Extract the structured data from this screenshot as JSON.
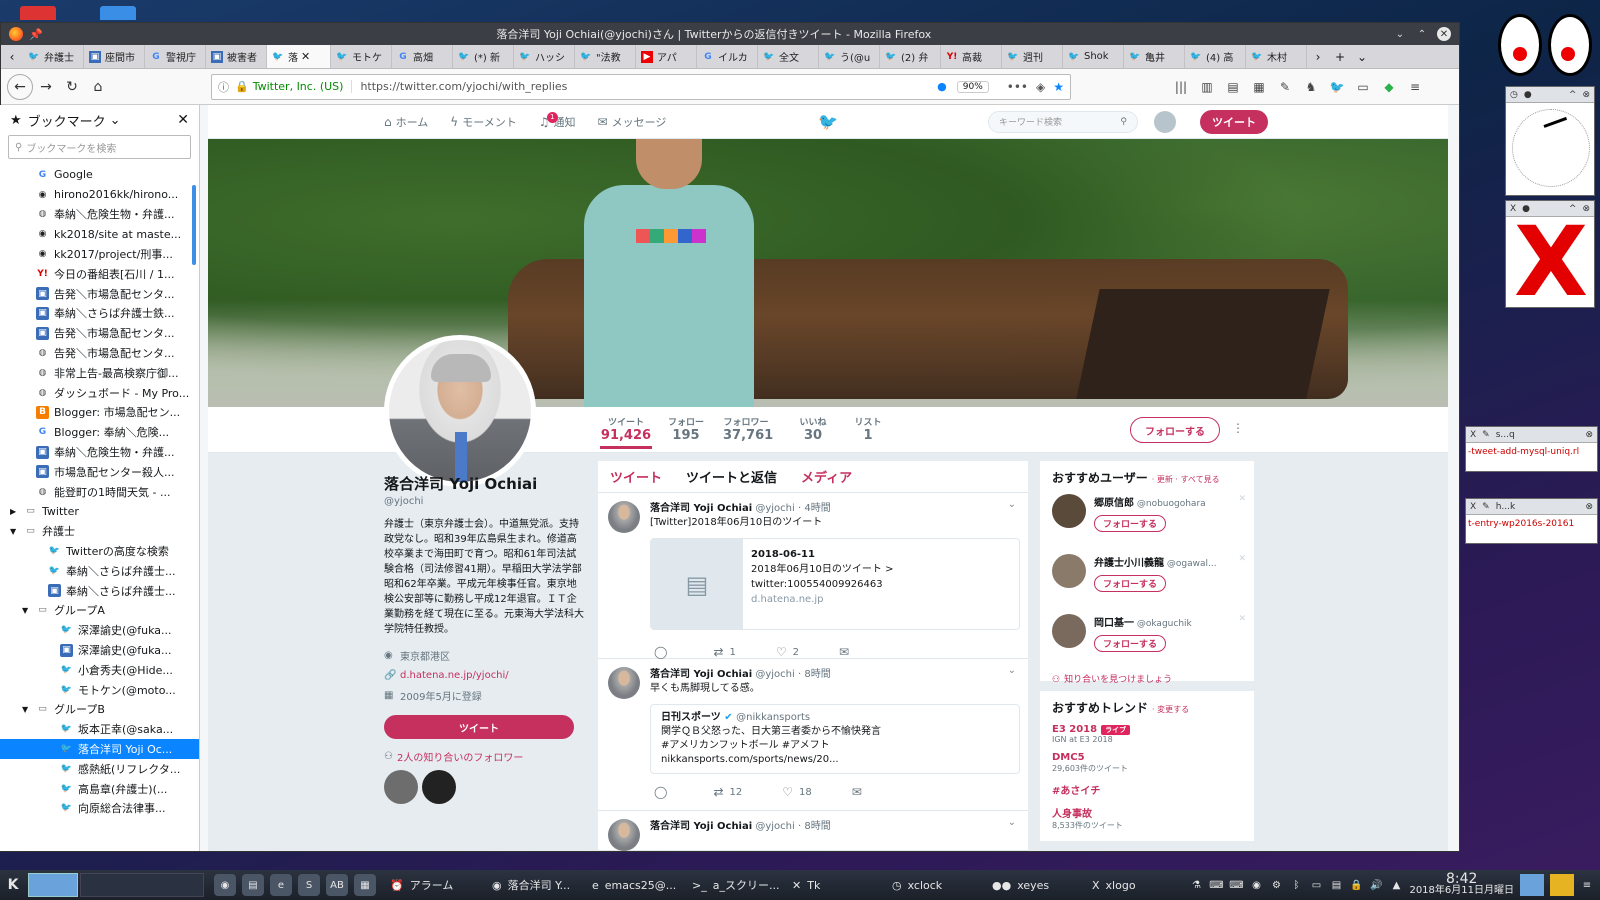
{
  "window": {
    "title": "落合洋司 Yoji Ochiai(@yjochi)さん | Twitterからの返信付きツイート - Mozilla Firefox"
  },
  "tabs": [
    {
      "label": "弁護士",
      "icon": "twitter-icon"
    },
    {
      "label": "座間市",
      "icon": "page-icon"
    },
    {
      "label": "警視庁",
      "icon": "google-icon"
    },
    {
      "label": "被害者",
      "icon": "page-icon"
    },
    {
      "label": "落",
      "icon": "twitter-icon",
      "active": true
    },
    {
      "label": "モトケ",
      "icon": "twitter-icon"
    },
    {
      "label": "高畑",
      "icon": "google-icon"
    },
    {
      "label": "(*) 新",
      "icon": "twitter-icon"
    },
    {
      "label": "ハッシ",
      "icon": "twitter-icon"
    },
    {
      "label": "\"法教",
      "icon": "twitter-icon"
    },
    {
      "label": "アパ",
      "icon": "youtube-icon"
    },
    {
      "label": "イルカ",
      "icon": "google-icon"
    },
    {
      "label": "全文",
      "icon": "twitter-icon"
    },
    {
      "label": "う(@u",
      "icon": "twitter-icon"
    },
    {
      "label": "(2) 弁",
      "icon": "twitter-icon"
    },
    {
      "label": "高裁",
      "icon": "yahoo-icon"
    },
    {
      "label": "週刊",
      "icon": "twitter-icon"
    },
    {
      "label": "Shok",
      "icon": "twitter-icon"
    },
    {
      "label": "亀井",
      "icon": "twitter-icon"
    },
    {
      "label": "(4) 高",
      "icon": "twitter-icon"
    },
    {
      "label": "木村",
      "icon": "twitter-icon"
    }
  ],
  "urlbar": {
    "identity": "Twitter, Inc. (US)",
    "url": "https://twitter.com/yjochi/with_replies",
    "zoom": "90%"
  },
  "sidebar": {
    "title": "ブックマーク",
    "search_placeholder": "ブックマークを検索",
    "items": [
      {
        "label": "Google",
        "icon": "google-icon",
        "indent": 3
      },
      {
        "label": "hirono2016kk/hirono...",
        "icon": "github-icon",
        "indent": 3
      },
      {
        "label": "奉納＼危険生物・弁護...",
        "icon": "globe-icon",
        "indent": 3
      },
      {
        "label": "kk2018/site at maste...",
        "icon": "github-icon",
        "indent": 3
      },
      {
        "label": "kk2017/project/刑事...",
        "icon": "github-icon",
        "indent": 3
      },
      {
        "label": "今日の番組表[石川 / 1...",
        "icon": "yahoo-icon",
        "indent": 3
      },
      {
        "label": "告発＼市場急配センタ...",
        "icon": "page-icon",
        "indent": 3
      },
      {
        "label": "奉納＼さらば弁護士鉄...",
        "icon": "page-icon",
        "indent": 3
      },
      {
        "label": "告発＼市場急配センタ...",
        "icon": "page-icon",
        "indent": 3
      },
      {
        "label": "告発＼市場急配センタ...",
        "icon": "globe-icon",
        "indent": 3
      },
      {
        "label": "非常上告-最高検察庁御...",
        "icon": "globe-icon",
        "indent": 3
      },
      {
        "label": "ダッシュボード - My Pro...",
        "icon": "globe-icon",
        "indent": 3
      },
      {
        "label": "Blogger: 市場急配セン...",
        "icon": "blogger-icon",
        "indent": 3
      },
      {
        "label": "Blogger: 奉納＼危険...",
        "icon": "google-icon",
        "indent": 3
      },
      {
        "label": "奉納＼危険生物・弁護...",
        "icon": "page-icon",
        "indent": 3
      },
      {
        "label": "市場急配センター殺人...",
        "icon": "page-icon",
        "indent": 3
      },
      {
        "label": "能登町の1時間天気 - ...",
        "icon": "globe-icon",
        "indent": 3
      },
      {
        "label": "Twitter",
        "icon": "folder-icon",
        "indent": 2,
        "arrow": "▶"
      },
      {
        "label": "弁護士",
        "icon": "folder-icon",
        "indent": 2,
        "arrow": "▼"
      },
      {
        "label": "Twitterの高度な検索",
        "icon": "twitter-icon",
        "indent": 4
      },
      {
        "label": "奉納＼さらば弁護士...",
        "icon": "twitter-icon",
        "indent": 4
      },
      {
        "label": "奉納＼さらば弁護士...",
        "icon": "page-icon",
        "indent": 4
      },
      {
        "label": "グループA",
        "icon": "folder-icon",
        "indent": 3,
        "arrow": "▼"
      },
      {
        "label": "深澤諭史(@fuka...",
        "icon": "twitter-icon",
        "indent": 5
      },
      {
        "label": "深澤諭史(@fuka...",
        "icon": "page-icon",
        "indent": 5
      },
      {
        "label": "小倉秀夫(@Hide...",
        "icon": "twitter-icon",
        "indent": 5
      },
      {
        "label": "モトケン(@moto...",
        "icon": "twitter-icon",
        "indent": 5
      },
      {
        "label": "グループB",
        "icon": "folder-icon",
        "indent": 3,
        "arrow": "▼"
      },
      {
        "label": "坂本正幸(@saka...",
        "icon": "twitter-icon",
        "indent": 5
      },
      {
        "label": "落合洋司 Yoji Oc...",
        "icon": "twitter-icon",
        "indent": 5,
        "selected": true
      },
      {
        "label": "感熱紙(リフレクタ...",
        "icon": "twitter-icon",
        "indent": 5
      },
      {
        "label": "高島章(弁護士)(...",
        "icon": "twitter-icon",
        "indent": 5
      },
      {
        "label": "向原総合法律事...",
        "icon": "twitter-icon",
        "indent": 5
      }
    ]
  },
  "twnav": {
    "home": "ホーム",
    "moments": "モーメント",
    "notifications": "通知",
    "notif_count": "1",
    "messages": "メッセージ",
    "search_placeholder": "キーワード検索",
    "tweet_button": "ツイート"
  },
  "profile": {
    "stats": [
      {
        "label": "ツイート",
        "value": "91,426"
      },
      {
        "label": "フォロー",
        "value": "195"
      },
      {
        "label": "フォロワー",
        "value": "37,761"
      },
      {
        "label": "いいね",
        "value": "30"
      },
      {
        "label": "リスト",
        "value": "1"
      }
    ],
    "follow_button": "フォローする",
    "name": "落合洋司 Yoji Ochiai",
    "handle": "@yjochi",
    "bio": "弁護士（東京弁護士会）。中道無党派。支持政党なし。昭和39年広島県生まれ。修道高校卒業まで海田町で育つ。昭和61年司法試験合格（司法修習41期）。早稲田大学法学部昭和62年卒業。平成元年検事任官。東京地検公安部等に勤務し平成12年退官。ＩＴ企業勤務を経て現在に至る。元東海大学法科大学院特任教授。",
    "location": "東京都港区",
    "website": "d.hatena.ne.jp/yjochi/",
    "joined": "2009年5月に登録",
    "tweet_button": "ツイート",
    "mutual_followers": "2人の知り合いのフォロワー"
  },
  "timeline": {
    "tabs": [
      "ツイート",
      "ツイートと返信",
      "メディア"
    ],
    "tweets": [
      {
        "name": "落合洋司 Yoji Ochiai",
        "handle": "@yjochi",
        "time": "4時間",
        "text": "[Twitter]2018年06月10日のツイート",
        "card_title": "2018-06-11",
        "card_desc": "2018年06月10日のツイート > twitter:100554009926463",
        "card_domain": "d.hatena.ne.jp",
        "retweets": "1",
        "likes": "2"
      },
      {
        "name": "落合洋司 Yoji Ochiai",
        "handle": "@yjochi",
        "time": "8時間",
        "text": "早くも馬脚現してる感。",
        "quote_name": "日刊スポーツ",
        "quote_handle": "@nikkansports",
        "quote_line1": "関学ＱＢ父怒った、日大第三者委から不愉快発言",
        "quote_line2": "#アメリカンフットボール #アメフト",
        "quote_line3": "nikkansports.com/sports/news/20...",
        "retweets": "12",
        "likes": "18"
      },
      {
        "name": "落合洋司 Yoji Ochiai",
        "handle": "@yjochi",
        "time": "8時間"
      }
    ]
  },
  "suggestions": {
    "title": "おすすめユーザー",
    "refresh": "· 更新 · すべて見る",
    "users": [
      {
        "name": "郷原信郎",
        "handle": "@nobuogohara",
        "button": "フォローする"
      },
      {
        "name": "弁護士小川義龍",
        "handle": "@ogawal...",
        "button": "フォローする"
      },
      {
        "name": "岡口基一",
        "handle": "@okaguchik",
        "button": "フォローする"
      }
    ],
    "find_friends": "知り合いを見つけましょう"
  },
  "trends": {
    "title": "おすすめトレンド",
    "change": "· 変更する",
    "items": [
      {
        "name": "E3 2018",
        "live": "ライブ",
        "sub": "IGN at E3 2018"
      },
      {
        "name": "DMC5",
        "sub": "29,603件のツイート"
      },
      {
        "name": "#あさイチ",
        "sub": ""
      },
      {
        "name": "人身事故",
        "sub": "8,533件のツイート"
      }
    ]
  },
  "widgets": {
    "term1": "-tweet-add-mysql-uniq.rl",
    "term2": "t-entry-wp2016s-20161",
    "term1_title": "s...q",
    "term2_title": "h...k"
  },
  "taskbar": {
    "tasks": [
      {
        "label": "アラーム",
        "icon": "alarm-icon"
      },
      {
        "label": "落合洋司 Y...",
        "icon": "firefox-icon"
      },
      {
        "label": "emacs25@...",
        "icon": "emacs-icon"
      },
      {
        "label": "a_スクリー...",
        "icon": "terminal-icon"
      },
      {
        "label": "Tk",
        "icon": "tk-icon"
      },
      {
        "label": "xclock",
        "icon": "clock-icon"
      },
      {
        "label": "xeyes",
        "icon": "eyes-icon"
      },
      {
        "label": "xlogo",
        "icon": "x-icon"
      }
    ],
    "time": "8:42",
    "date": "2018年6月11日月曜日"
  },
  "colors": {
    "accent": "#c5305e",
    "twitter_blue": "#1da1f2",
    "selection": "#0a84ff"
  }
}
